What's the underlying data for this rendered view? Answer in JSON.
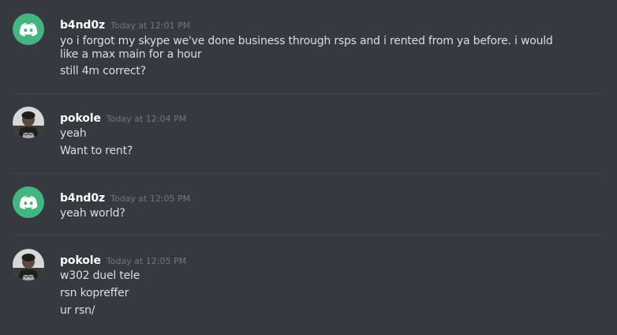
{
  "messages": [
    {
      "username": "b4nd0z",
      "timestamp": "Today at 12:01 PM",
      "avatar": "discord-logo",
      "lines": [
        "yo i forgot my skype we've done business through rsps and i rented from ya before. i would like a max main for a hour",
        "still 4m correct?"
      ]
    },
    {
      "username": "pokole",
      "timestamp": "Today at 12:04 PM",
      "avatar": "user-photo",
      "lines": [
        "yeah",
        "Want to rent?"
      ]
    },
    {
      "username": "b4nd0z",
      "timestamp": "Today at 12:05 PM",
      "avatar": "discord-logo",
      "lines": [
        "yeah world?"
      ]
    },
    {
      "username": "pokole",
      "timestamp": "Today at 12:05 PM",
      "avatar": "user-photo",
      "lines": [
        "w302 duel tele",
        "rsn kopreffer",
        "ur rsn/"
      ]
    }
  ],
  "colors": {
    "background": "#36393f",
    "discord_avatar": "#43b581",
    "username": "#ffffff",
    "timestamp": "#72767d",
    "text": "#dcddde",
    "divider": "#40444b"
  }
}
